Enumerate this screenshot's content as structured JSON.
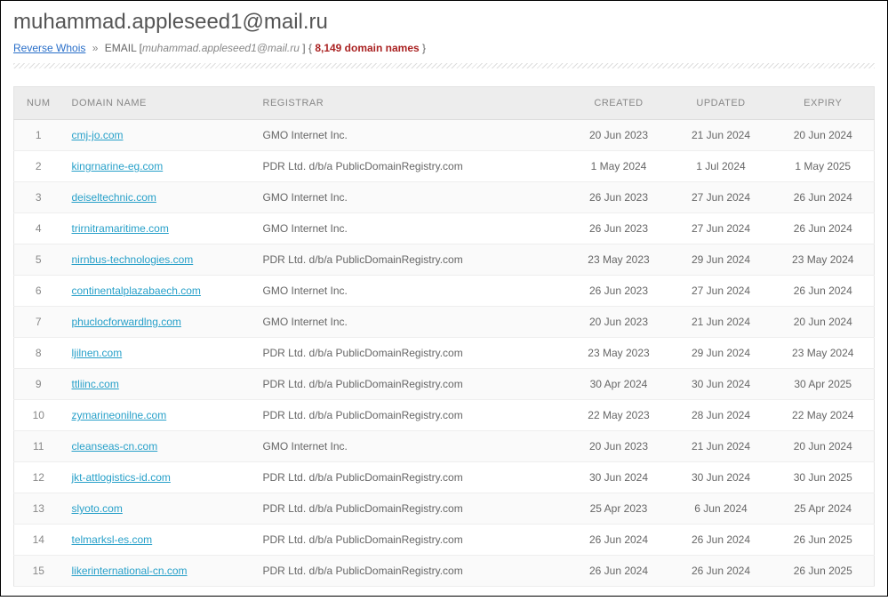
{
  "title": "muhammad.appleseed1@mail.ru",
  "breadcrumb": {
    "reverse_whois_label": "Reverse Whois",
    "separator": "»",
    "tag_label": "EMAIL",
    "email": "muhammad.appleseed1@mail.ru",
    "count_open": "{",
    "count_text": "8,149 domain names",
    "count_close": "}"
  },
  "columns": {
    "num": "NUM",
    "domain": "DOMAIN NAME",
    "registrar": "REGISTRAR",
    "created": "CREATED",
    "updated": "UPDATED",
    "expiry": "EXPIRY"
  },
  "rows": [
    {
      "num": "1",
      "domain": "cmj-jo.com",
      "registrar": "GMO Internet Inc.",
      "created": "20 Jun 2023",
      "updated": "21 Jun 2024",
      "expiry": "20 Jun 2024"
    },
    {
      "num": "2",
      "domain": "kingrnarine-eg.com",
      "registrar": "PDR Ltd. d/b/a PublicDomainRegistry.com",
      "created": "1 May 2024",
      "updated": "1 Jul 2024",
      "expiry": "1 May 2025"
    },
    {
      "num": "3",
      "domain": "deiseltechnic.com",
      "registrar": "GMO Internet Inc.",
      "created": "26 Jun 2023",
      "updated": "27 Jun 2024",
      "expiry": "26 Jun 2024"
    },
    {
      "num": "4",
      "domain": "trirnitramaritime.com",
      "registrar": "GMO Internet Inc.",
      "created": "26 Jun 2023",
      "updated": "27 Jun 2024",
      "expiry": "26 Jun 2024"
    },
    {
      "num": "5",
      "domain": "nirnbus-technologies.com",
      "registrar": "PDR Ltd. d/b/a PublicDomainRegistry.com",
      "created": "23 May 2023",
      "updated": "29 Jun 2024",
      "expiry": "23 May 2024"
    },
    {
      "num": "6",
      "domain": "continentalplazabaech.com",
      "registrar": "GMO Internet Inc.",
      "created": "26 Jun 2023",
      "updated": "27 Jun 2024",
      "expiry": "26 Jun 2024"
    },
    {
      "num": "7",
      "domain": "phuclocforwardlng.com",
      "registrar": "GMO Internet Inc.",
      "created": "20 Jun 2023",
      "updated": "21 Jun 2024",
      "expiry": "20 Jun 2024"
    },
    {
      "num": "8",
      "domain": "ljilnen.com",
      "registrar": "PDR Ltd. d/b/a PublicDomainRegistry.com",
      "created": "23 May 2023",
      "updated": "29 Jun 2024",
      "expiry": "23 May 2024"
    },
    {
      "num": "9",
      "domain": "ttliinc.com",
      "registrar": "PDR Ltd. d/b/a PublicDomainRegistry.com",
      "created": "30 Apr 2024",
      "updated": "30 Jun 2024",
      "expiry": "30 Apr 2025"
    },
    {
      "num": "10",
      "domain": "zymarineonilne.com",
      "registrar": "PDR Ltd. d/b/a PublicDomainRegistry.com",
      "created": "22 May 2023",
      "updated": "28 Jun 2024",
      "expiry": "22 May 2024"
    },
    {
      "num": "11",
      "domain": "cleanseas-cn.com",
      "registrar": "GMO Internet Inc.",
      "created": "20 Jun 2023",
      "updated": "21 Jun 2024",
      "expiry": "20 Jun 2024"
    },
    {
      "num": "12",
      "domain": "jkt-attlogistics-id.com",
      "registrar": "PDR Ltd. d/b/a PublicDomainRegistry.com",
      "created": "30 Jun 2024",
      "updated": "30 Jun 2024",
      "expiry": "30 Jun 2025"
    },
    {
      "num": "13",
      "domain": "slyoto.com",
      "registrar": "PDR Ltd. d/b/a PublicDomainRegistry.com",
      "created": "25 Apr 2023",
      "updated": "6 Jun 2024",
      "expiry": "25 Apr 2024"
    },
    {
      "num": "14",
      "domain": "telmarksl-es.com",
      "registrar": "PDR Ltd. d/b/a PublicDomainRegistry.com",
      "created": "26 Jun 2024",
      "updated": "26 Jun 2024",
      "expiry": "26 Jun 2025"
    },
    {
      "num": "15",
      "domain": "likerinternational-cn.com",
      "registrar": "PDR Ltd. d/b/a PublicDomainRegistry.com",
      "created": "26 Jun 2024",
      "updated": "26 Jun 2024",
      "expiry": "26 Jun 2025"
    }
  ]
}
